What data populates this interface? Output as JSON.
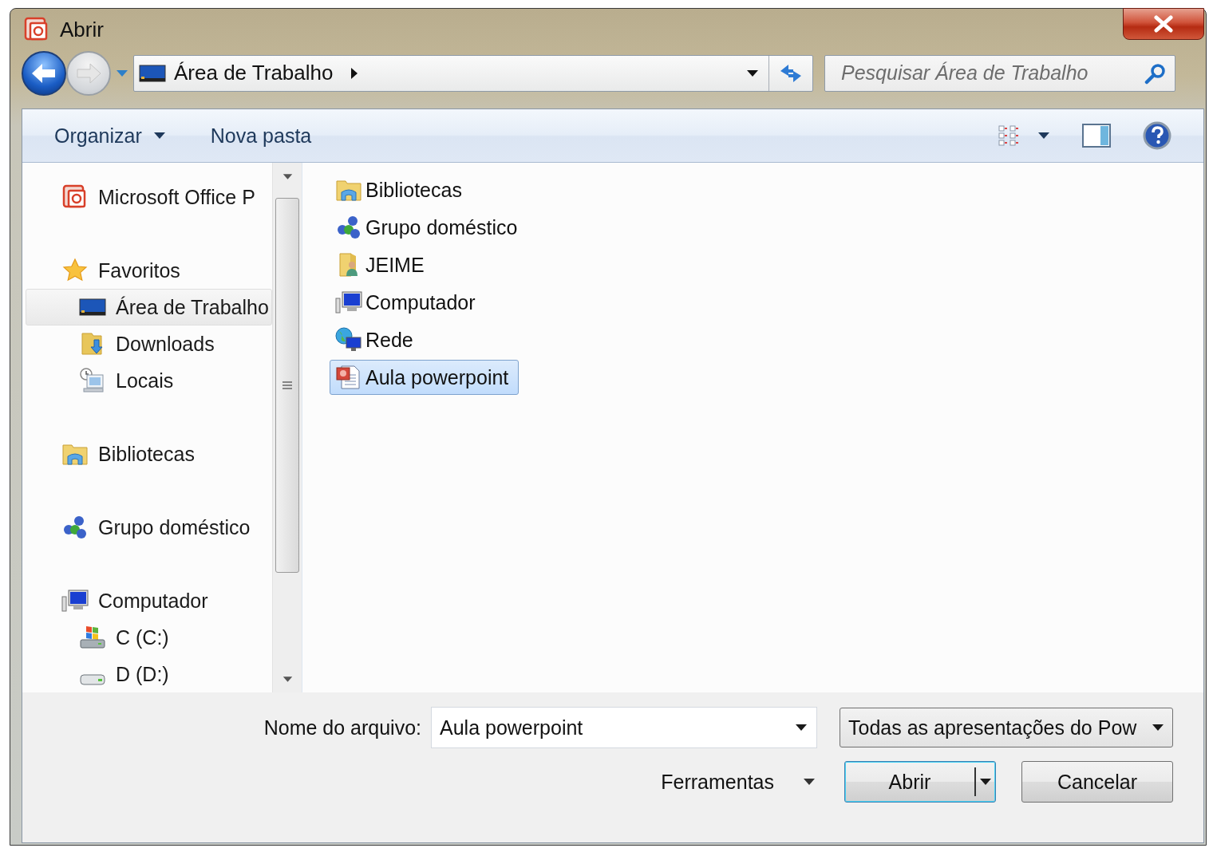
{
  "window": {
    "title": "Abrir"
  },
  "navigation": {
    "address": "Área de Trabalho",
    "search": {
      "placeholder": "Pesquisar Área de Trabalho"
    }
  },
  "toolbar": {
    "organize": "Organizar",
    "new_folder": "Nova pasta"
  },
  "sidebar": {
    "items": [
      {
        "kind": "app",
        "label": "Microsoft Office P",
        "selected": false
      },
      {
        "kind": "star",
        "label": "Favoritos",
        "selected": false,
        "children": [
          {
            "kind": "desktop",
            "label": "Área de Trabalho",
            "selected": true
          },
          {
            "kind": "downloads",
            "label": "Downloads",
            "selected": false
          },
          {
            "kind": "recent",
            "label": "Locais",
            "selected": false
          }
        ]
      },
      {
        "kind": "library",
        "label": "Bibliotecas",
        "selected": false
      },
      {
        "kind": "homegroup",
        "label": "Grupo doméstico",
        "selected": false
      },
      {
        "kind": "computer",
        "label": "Computador",
        "selected": false,
        "children": [
          {
            "kind": "system-drive",
            "label": "C (C:)",
            "selected": false
          },
          {
            "kind": "drive",
            "label": "D (D:)",
            "selected": false
          }
        ]
      }
    ]
  },
  "files": [
    {
      "kind": "library",
      "label": "Bibliotecas",
      "selected": false
    },
    {
      "kind": "homegroup",
      "label": "Grupo doméstico",
      "selected": false
    },
    {
      "kind": "user",
      "label": "JEIME",
      "selected": false
    },
    {
      "kind": "computer",
      "label": "Computador",
      "selected": false
    },
    {
      "kind": "network",
      "label": "Rede",
      "selected": false
    },
    {
      "kind": "presentation",
      "label": "Aula powerpoint",
      "selected": true
    }
  ],
  "footer": {
    "filename_label": "Nome do arquivo:",
    "filename": "Aula powerpoint",
    "filetype": "Todas as apresentações do Pow",
    "tools": "Ferramentas",
    "open": "Abrir",
    "cancel": "Cancelar"
  }
}
